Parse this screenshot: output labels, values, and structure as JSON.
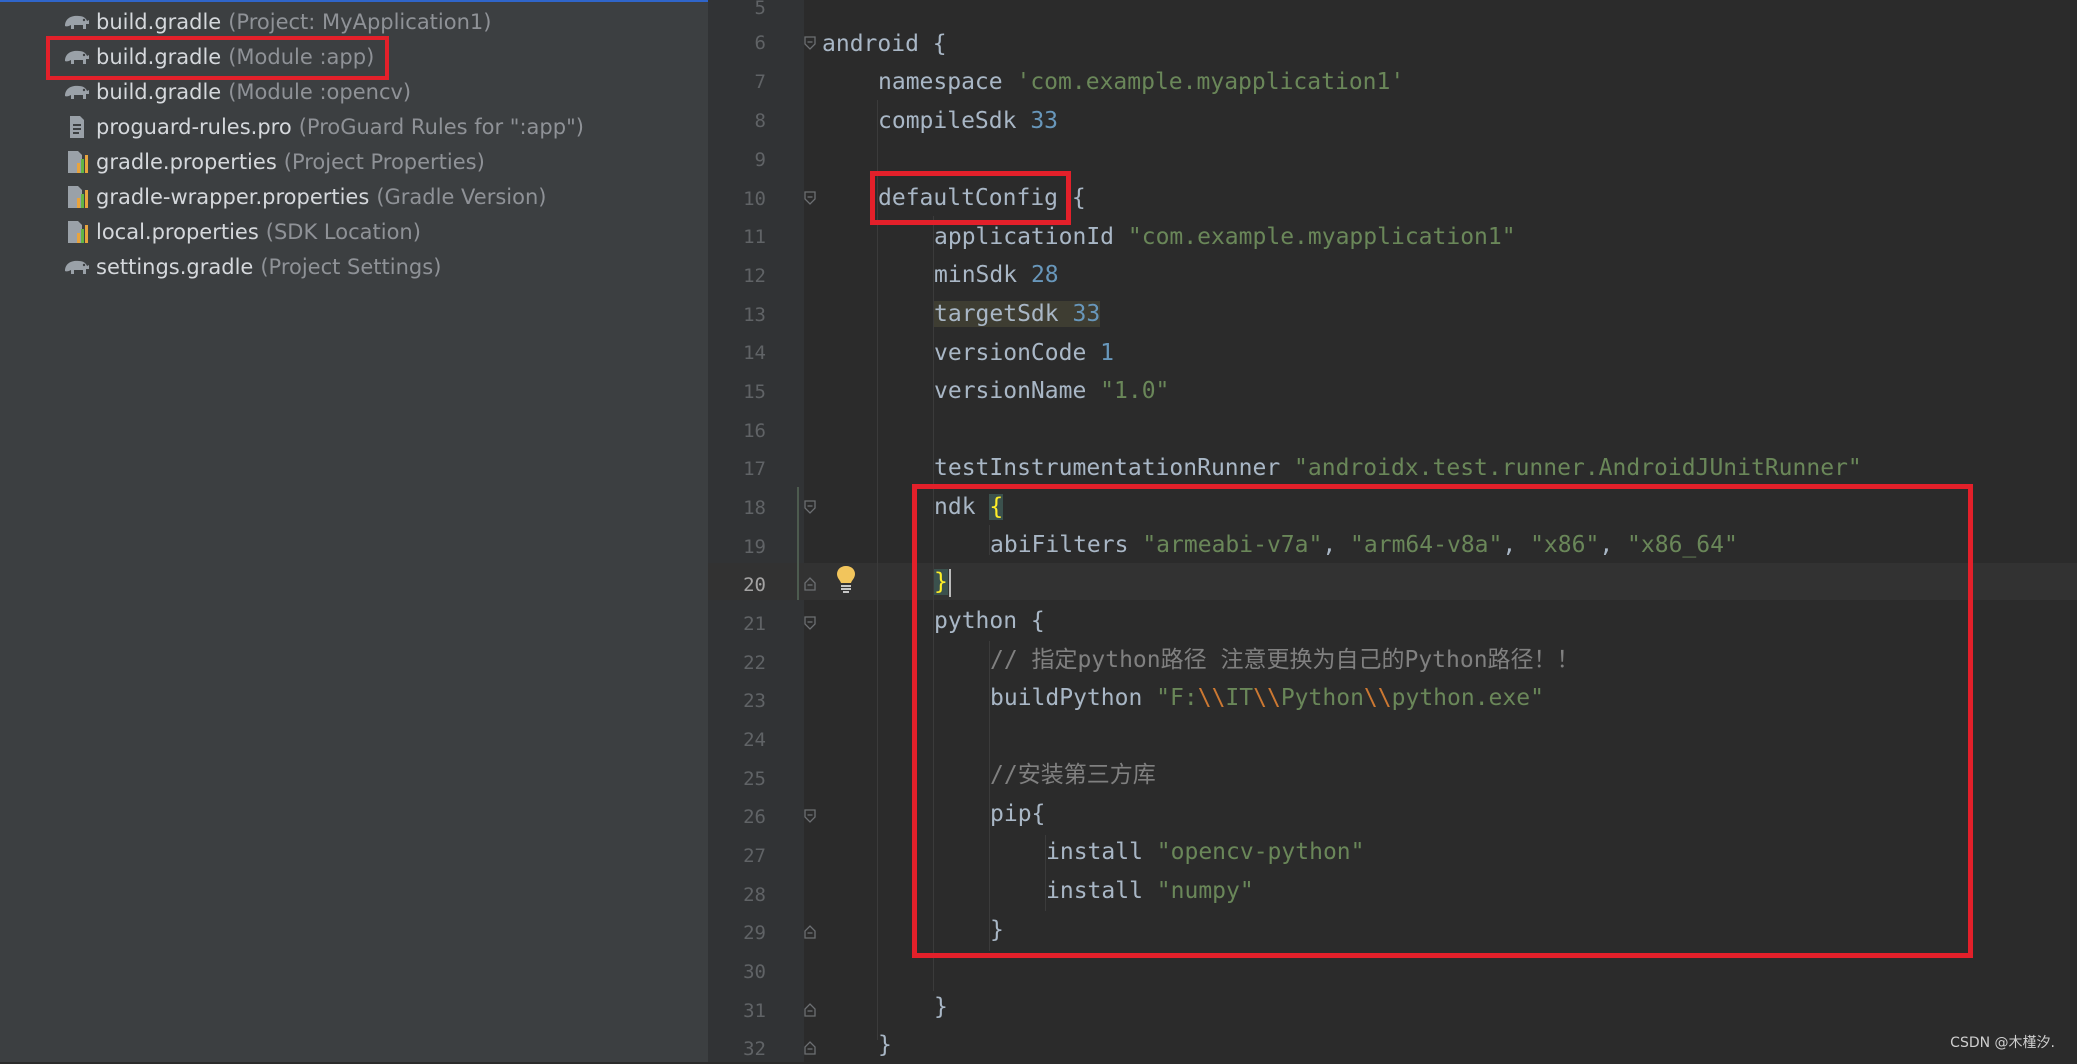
{
  "project_tree": {
    "items": [
      {
        "name": "build.gradle",
        "hint": "(Project: MyApplication1)",
        "icon": "gradle-elephant-icon"
      },
      {
        "name": "build.gradle",
        "hint": "(Module :app)",
        "icon": "gradle-elephant-icon"
      },
      {
        "name": "build.gradle",
        "hint": "(Module :opencv)",
        "icon": "gradle-elephant-icon"
      },
      {
        "name": "proguard-rules.pro",
        "hint": "(ProGuard Rules for \":app\")",
        "icon": "text-file-icon"
      },
      {
        "name": "gradle.properties",
        "hint": "(Project Properties)",
        "icon": "properties-file-icon"
      },
      {
        "name": "gradle-wrapper.properties",
        "hint": "(Gradle Version)",
        "icon": "properties-file-icon"
      },
      {
        "name": "local.properties",
        "hint": "(SDK Location)",
        "icon": "properties-file-icon"
      },
      {
        "name": "settings.gradle",
        "hint": "(Project Settings)",
        "icon": "gradle-elephant-icon"
      }
    ]
  },
  "editor": {
    "line_numbers": [
      "5",
      "6",
      "7",
      "8",
      "9",
      "10",
      "11",
      "12",
      "13",
      "14",
      "15",
      "16",
      "17",
      "18",
      "19",
      "20",
      "21",
      "22",
      "23",
      "24",
      "25",
      "26",
      "27",
      "28",
      "29",
      "30",
      "31",
      "32"
    ],
    "current_line": "20",
    "code": {
      "l6_kw": "android",
      "l6_brace": " {",
      "l7_key": "namespace ",
      "l7_val": "'com.example.myapplication1'",
      "l8_key": "compileSdk ",
      "l8_val": "33",
      "l10_key": "defaultConfig",
      "l10_brace": " {",
      "l11_key": "applicationId ",
      "l11_val": "\"com.example.myapplication1\"",
      "l12_key": "minSdk ",
      "l12_val": "28",
      "l13_key": "targetSdk ",
      "l13_val": "33",
      "l14_key": "versionCode ",
      "l14_val": "1",
      "l15_key": "versionName ",
      "l15_val": "\"1.0\"",
      "l17_key": "testInstrumentationRunner ",
      "l17_val": "\"androidx.test.runner.AndroidJUnitRunner\"",
      "l18_key": "ndk ",
      "l18_brace": "{",
      "l19_key": "abiFilters ",
      "l19_v1": "\"armeabi-v7a\"",
      "l19_sep1": ", ",
      "l19_v2": "\"arm64-v8a\"",
      "l19_sep2": ", ",
      "l19_v3": "\"x86\"",
      "l19_sep3": ", ",
      "l19_v4": "\"x86_64\"",
      "l20_brace": "}",
      "l21_key": "python {",
      "l22_comment": "// 指定python路径 注意更换为自己的Python路径！！",
      "l23_key": "buildPython ",
      "l23_v_a": "\"F:",
      "l23_esc1": "\\\\",
      "l23_v_b": "IT",
      "l23_esc2": "\\\\",
      "l23_v_c": "Python",
      "l23_esc3": "\\\\",
      "l23_v_d": "python.exe\"",
      "l25_comment": "//安装第三方库",
      "l26_key": "pip{",
      "l27_key": "install ",
      "l27_val": "\"opencv-python\"",
      "l28_key": "install ",
      "l28_val": "\"numpy\"",
      "l29_brace": "}",
      "l31_brace": "}",
      "l32_brace": "}"
    }
  },
  "watermark": "CSDN @木槿汐.",
  "colors": {
    "highlight_box": "#e3202a",
    "panel_bg": "#3c3f41",
    "editor_bg": "#2b2b2b",
    "string": "#6a8759",
    "number": "#6897bb"
  }
}
